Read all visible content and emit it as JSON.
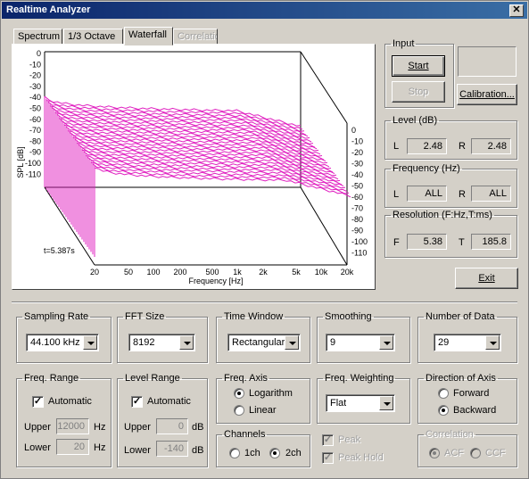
{
  "window": {
    "title": "Realtime Analyzer",
    "close_glyph": "✕"
  },
  "tabs": [
    {
      "label": "Spectrum",
      "state": "normal"
    },
    {
      "label": "1/3 Octave",
      "state": "normal"
    },
    {
      "label": "Waterfall",
      "state": "active"
    },
    {
      "label": "Correlation",
      "state": "disabled"
    }
  ],
  "waterfall": {
    "ylabel": "SPL [dB]",
    "xlabel": "Frequency [Hz]",
    "left_ticks": [
      "0",
      "-10",
      "-20",
      "-30",
      "-40",
      "-50",
      "-60",
      "-70",
      "-80",
      "-90",
      "-100",
      "-110"
    ],
    "right_ticks": [
      "0",
      "-10",
      "-20",
      "-30",
      "-40",
      "-50",
      "-60",
      "-70",
      "-80",
      "-90",
      "-100",
      "-110"
    ],
    "x_ticks": [
      "20",
      "50",
      "100",
      "200",
      "500",
      "1k",
      "2k",
      "5k",
      "10k",
      "20k"
    ],
    "time_label": "t=5.387s",
    "trace_color": "#e020c0"
  },
  "input": {
    "legend": "Input",
    "start": "Start",
    "stop": "Stop",
    "calibration": "Calibration..."
  },
  "level": {
    "legend": "Level (dB)",
    "l_label": "L",
    "l_value": "2.48",
    "r_label": "R",
    "r_value": "2.48"
  },
  "frequency": {
    "legend": "Frequency (Hz)",
    "l_label": "L",
    "l_value": "ALL",
    "r_label": "R",
    "r_value": "ALL"
  },
  "resolution": {
    "legend": "Resolution (F:Hz,T:ms)",
    "f_label": "F",
    "f_value": "5.38",
    "t_label": "T",
    "t_value": "185.8"
  },
  "exit": "Exit",
  "sampling_rate": {
    "legend": "Sampling Rate",
    "value": "44.100 kHz"
  },
  "fft_size": {
    "legend": "FFT Size",
    "value": "8192"
  },
  "time_window": {
    "legend": "Time Window",
    "value": "Rectangular"
  },
  "smoothing": {
    "legend": "Smoothing",
    "value": "9"
  },
  "number_of_data": {
    "legend": "Number of Data",
    "value": "29"
  },
  "freq_range": {
    "legend": "Freq. Range",
    "automatic": "Automatic",
    "upper_label": "Upper",
    "upper_value": "12000",
    "upper_unit": "Hz",
    "lower_label": "Lower",
    "lower_value": "20",
    "lower_unit": "Hz"
  },
  "level_range": {
    "legend": "Level Range",
    "automatic": "Automatic",
    "upper_label": "Upper",
    "upper_value": "0",
    "upper_unit": "dB",
    "lower_label": "Lower",
    "lower_value": "-140",
    "lower_unit": "dB"
  },
  "freq_axis": {
    "legend": "Freq. Axis",
    "options": [
      "Logarithm",
      "Linear"
    ],
    "selected": "Logarithm"
  },
  "channels": {
    "legend": "Channels",
    "options": [
      "1ch",
      "2ch"
    ],
    "selected": "2ch"
  },
  "freq_weighting": {
    "legend": "Freq. Weighting",
    "value": "Flat"
  },
  "peak": {
    "peak": "Peak",
    "peak_hold": "Peak Hold"
  },
  "direction": {
    "legend": "Direction of Axis",
    "options": [
      "Forward",
      "Backward"
    ],
    "selected": "Backward"
  },
  "correlation": {
    "legend": "Correlation",
    "options": [
      "ACF",
      "CCF"
    ],
    "selected": "ACF"
  }
}
